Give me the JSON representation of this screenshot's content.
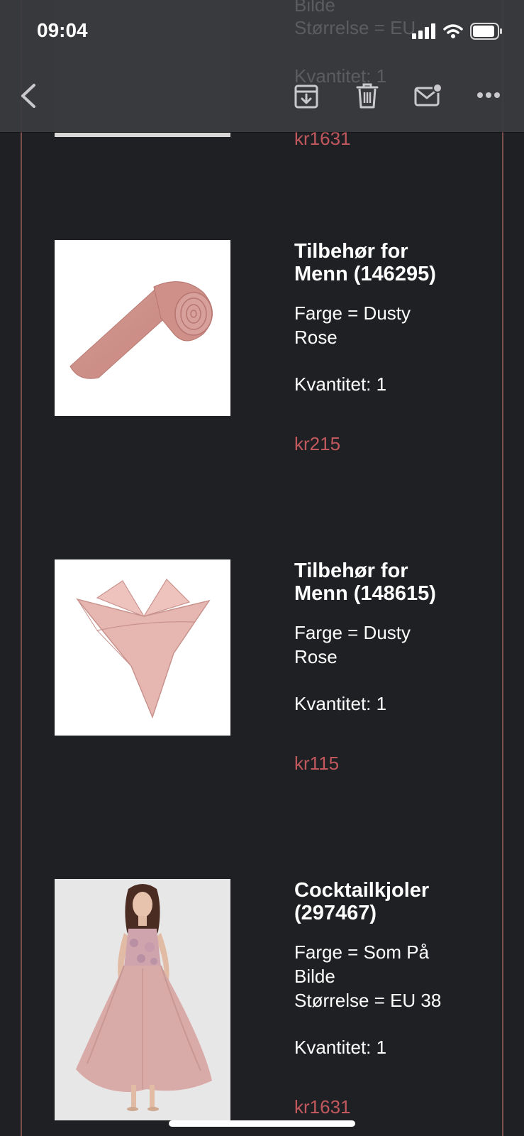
{
  "status_bar": {
    "time": "09:04"
  },
  "header_ghost": {
    "line1": "Bilde",
    "line2": "Størrelse = EU",
    "line3": "Kvantitet: 1",
    "price": "kr1631"
  },
  "toolbar": {
    "back_icon": "chevron-left-icon",
    "archive_icon": "archive-icon",
    "trash_icon": "trash-icon",
    "mail_icon": "mail-unread-icon",
    "more_icon": "more-icon"
  },
  "products": [
    {
      "title_line1": "Tilbehør for",
      "title_line2": "Menn (146295)",
      "attr_line1": "Farge = Dusty",
      "attr_line2": "Rose",
      "qty": "Kvantitet: 1",
      "price": "kr215"
    },
    {
      "title_line1": "Tilbehør for",
      "title_line2": "Menn (148615)",
      "attr_line1": "Farge = Dusty",
      "attr_line2": "Rose",
      "qty": "Kvantitet: 1",
      "price": "kr115"
    },
    {
      "title_line1": "Cocktailkjoler",
      "title_line2": "(297467)",
      "attr_line1": "Farge = Som På",
      "attr_line2": "Bilde",
      "attr_line3": "Størrelse = EU 38",
      "qty": "Kvantitet: 1",
      "price": "kr1631"
    }
  ],
  "colors": {
    "background": "#1f2023",
    "price": "#c0585e",
    "frame": "#7a4f4c"
  }
}
